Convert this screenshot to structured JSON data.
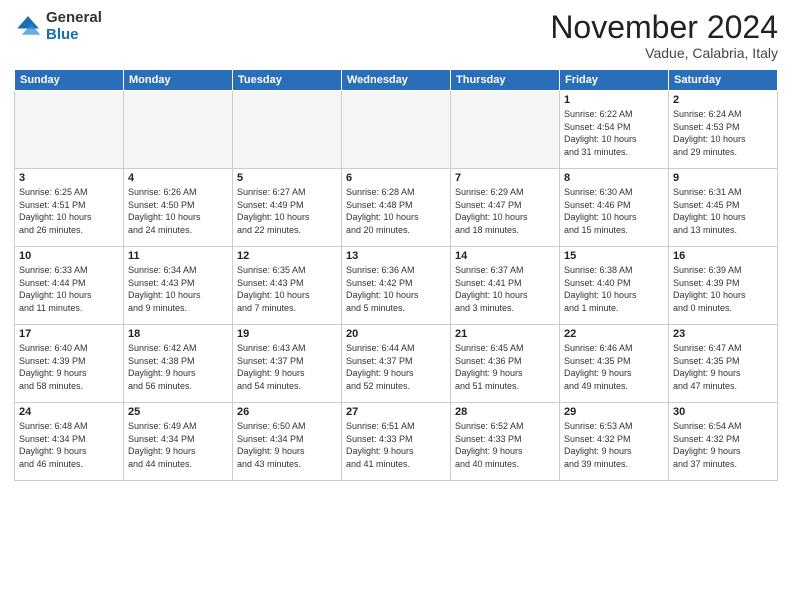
{
  "header": {
    "logo_general": "General",
    "logo_blue": "Blue",
    "month_title": "November 2024",
    "location": "Vadue, Calabria, Italy"
  },
  "days_of_week": [
    "Sunday",
    "Monday",
    "Tuesday",
    "Wednesday",
    "Thursday",
    "Friday",
    "Saturday"
  ],
  "weeks": [
    [
      {
        "day": "",
        "info": ""
      },
      {
        "day": "",
        "info": ""
      },
      {
        "day": "",
        "info": ""
      },
      {
        "day": "",
        "info": ""
      },
      {
        "day": "",
        "info": ""
      },
      {
        "day": "1",
        "info": "Sunrise: 6:22 AM\nSunset: 4:54 PM\nDaylight: 10 hours\nand 31 minutes."
      },
      {
        "day": "2",
        "info": "Sunrise: 6:24 AM\nSunset: 4:53 PM\nDaylight: 10 hours\nand 29 minutes."
      }
    ],
    [
      {
        "day": "3",
        "info": "Sunrise: 6:25 AM\nSunset: 4:51 PM\nDaylight: 10 hours\nand 26 minutes."
      },
      {
        "day": "4",
        "info": "Sunrise: 6:26 AM\nSunset: 4:50 PM\nDaylight: 10 hours\nand 24 minutes."
      },
      {
        "day": "5",
        "info": "Sunrise: 6:27 AM\nSunset: 4:49 PM\nDaylight: 10 hours\nand 22 minutes."
      },
      {
        "day": "6",
        "info": "Sunrise: 6:28 AM\nSunset: 4:48 PM\nDaylight: 10 hours\nand 20 minutes."
      },
      {
        "day": "7",
        "info": "Sunrise: 6:29 AM\nSunset: 4:47 PM\nDaylight: 10 hours\nand 18 minutes."
      },
      {
        "day": "8",
        "info": "Sunrise: 6:30 AM\nSunset: 4:46 PM\nDaylight: 10 hours\nand 15 minutes."
      },
      {
        "day": "9",
        "info": "Sunrise: 6:31 AM\nSunset: 4:45 PM\nDaylight: 10 hours\nand 13 minutes."
      }
    ],
    [
      {
        "day": "10",
        "info": "Sunrise: 6:33 AM\nSunset: 4:44 PM\nDaylight: 10 hours\nand 11 minutes."
      },
      {
        "day": "11",
        "info": "Sunrise: 6:34 AM\nSunset: 4:43 PM\nDaylight: 10 hours\nand 9 minutes."
      },
      {
        "day": "12",
        "info": "Sunrise: 6:35 AM\nSunset: 4:43 PM\nDaylight: 10 hours\nand 7 minutes."
      },
      {
        "day": "13",
        "info": "Sunrise: 6:36 AM\nSunset: 4:42 PM\nDaylight: 10 hours\nand 5 minutes."
      },
      {
        "day": "14",
        "info": "Sunrise: 6:37 AM\nSunset: 4:41 PM\nDaylight: 10 hours\nand 3 minutes."
      },
      {
        "day": "15",
        "info": "Sunrise: 6:38 AM\nSunset: 4:40 PM\nDaylight: 10 hours\nand 1 minute."
      },
      {
        "day": "16",
        "info": "Sunrise: 6:39 AM\nSunset: 4:39 PM\nDaylight: 10 hours\nand 0 minutes."
      }
    ],
    [
      {
        "day": "17",
        "info": "Sunrise: 6:40 AM\nSunset: 4:39 PM\nDaylight: 9 hours\nand 58 minutes."
      },
      {
        "day": "18",
        "info": "Sunrise: 6:42 AM\nSunset: 4:38 PM\nDaylight: 9 hours\nand 56 minutes."
      },
      {
        "day": "19",
        "info": "Sunrise: 6:43 AM\nSunset: 4:37 PM\nDaylight: 9 hours\nand 54 minutes."
      },
      {
        "day": "20",
        "info": "Sunrise: 6:44 AM\nSunset: 4:37 PM\nDaylight: 9 hours\nand 52 minutes."
      },
      {
        "day": "21",
        "info": "Sunrise: 6:45 AM\nSunset: 4:36 PM\nDaylight: 9 hours\nand 51 minutes."
      },
      {
        "day": "22",
        "info": "Sunrise: 6:46 AM\nSunset: 4:35 PM\nDaylight: 9 hours\nand 49 minutes."
      },
      {
        "day": "23",
        "info": "Sunrise: 6:47 AM\nSunset: 4:35 PM\nDaylight: 9 hours\nand 47 minutes."
      }
    ],
    [
      {
        "day": "24",
        "info": "Sunrise: 6:48 AM\nSunset: 4:34 PM\nDaylight: 9 hours\nand 46 minutes."
      },
      {
        "day": "25",
        "info": "Sunrise: 6:49 AM\nSunset: 4:34 PM\nDaylight: 9 hours\nand 44 minutes."
      },
      {
        "day": "26",
        "info": "Sunrise: 6:50 AM\nSunset: 4:34 PM\nDaylight: 9 hours\nand 43 minutes."
      },
      {
        "day": "27",
        "info": "Sunrise: 6:51 AM\nSunset: 4:33 PM\nDaylight: 9 hours\nand 41 minutes."
      },
      {
        "day": "28",
        "info": "Sunrise: 6:52 AM\nSunset: 4:33 PM\nDaylight: 9 hours\nand 40 minutes."
      },
      {
        "day": "29",
        "info": "Sunrise: 6:53 AM\nSunset: 4:32 PM\nDaylight: 9 hours\nand 39 minutes."
      },
      {
        "day": "30",
        "info": "Sunrise: 6:54 AM\nSunset: 4:32 PM\nDaylight: 9 hours\nand 37 minutes."
      }
    ]
  ]
}
